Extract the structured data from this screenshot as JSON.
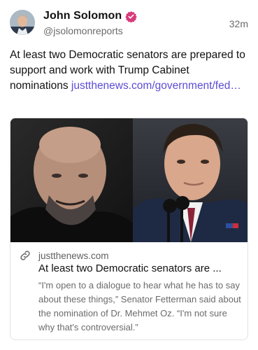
{
  "author": {
    "display_name": "John Solomon",
    "handle": "@jsolomonreports",
    "verified_icon": "verified-badge-icon"
  },
  "post": {
    "timestamp": "32m",
    "text": "At least two Democratic senators are prepared to support and work with Trump Cabinet nominations ",
    "link_text": "justthenews.com/government/fed…"
  },
  "link_card": {
    "domain": "justthenews.com",
    "title": "At least two Democratic senators are ...",
    "description": "“I'm open to a dialogue to hear what he has to say about these things,” Senator Fetterman said about the nomination of Dr. Mehmet Oz. “I'm not sure why that's controversial.”",
    "icon": "link-icon"
  },
  "colors": {
    "accent": "#5b4cd6",
    "verified": "#d83a7a",
    "muted_text": "#6b6b6b"
  }
}
